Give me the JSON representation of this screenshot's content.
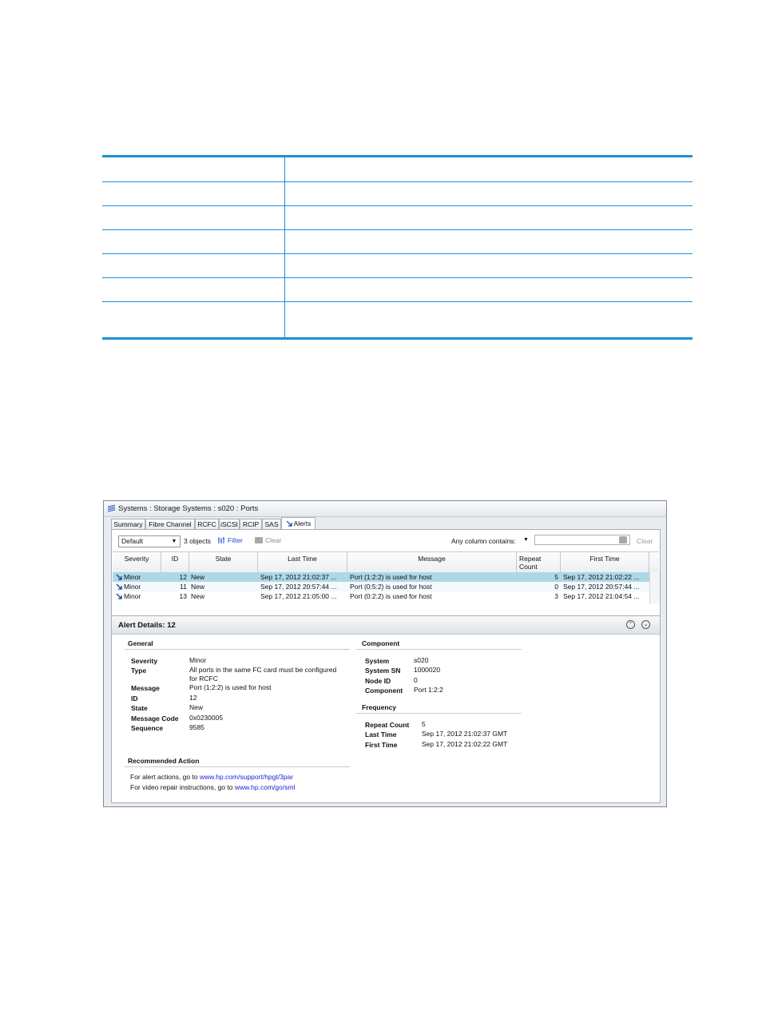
{
  "window": {
    "title": "Systems : Storage Systems : s020 : Ports"
  },
  "tabs": [
    "Summary",
    "Fibre Channel",
    "RCFC",
    "iSCSI",
    "RCIP",
    "SAS",
    "Alerts"
  ],
  "active_tab": "Alerts",
  "toolbar": {
    "filter_select": "Default",
    "object_count": "3 objects",
    "filter_label": "Filter",
    "clear_label": "Clear",
    "search_label": "Any column contains:",
    "search_value": "",
    "search_clear_label": "Clear"
  },
  "grid": {
    "columns": [
      "Severity",
      "ID",
      "State",
      "Last Time",
      "Message",
      "Repeat Count",
      "First Time"
    ],
    "rows": [
      {
        "severity": "Minor",
        "id": "12",
        "state": "New",
        "last_time": "Sep 17, 2012 21:02:37 ...",
        "message": "Port (1:2:2) is used for host",
        "repeat": "5",
        "first_time": "Sep 17, 2012 21:02:22 ..."
      },
      {
        "severity": "Minor",
        "id": "11",
        "state": "New",
        "last_time": "Sep 17, 2012 20:57:44 ...",
        "message": "Port (0:5:2) is used for host",
        "repeat": "0",
        "first_time": "Sep 17, 2012 20:57:44 ..."
      },
      {
        "severity": "Minor",
        "id": "13",
        "state": "New",
        "last_time": "Sep 17, 2012 21:05:00 ...",
        "message": "Port (0:2:2) is used for host",
        "repeat": "3",
        "first_time": "Sep 17, 2012 21:04:54 ..."
      }
    ],
    "selected_row": 0
  },
  "details": {
    "title": "Alert Details: 12",
    "general": {
      "title": "General",
      "severity_label": "Severity",
      "severity": "Minor",
      "type_label": "Type",
      "type_line1": "All ports in the same FC card must be configured",
      "type_line2": "for RCFC",
      "message_label": "Message",
      "message": "Port (1:2:2) is used for host",
      "id_label": "ID",
      "id": "12",
      "state_label": "State",
      "state": "New",
      "code_label": "Message Code",
      "code": "0x0230005",
      "sequence_label": "Sequence",
      "sequence": "9585"
    },
    "component": {
      "title": "Component",
      "system_label": "System",
      "system": "s020",
      "sn_label": "System SN",
      "sn": "1000020",
      "node_label": "Node ID",
      "node": "0",
      "component_label": "Component",
      "component": "Port 1:2:2"
    },
    "frequency": {
      "title": "Frequency",
      "repeat_label": "Repeat Count",
      "repeat": "5",
      "last_label": "Last Time",
      "last": "Sep 17, 2012 21:02:37 GMT",
      "first_label": "First Time",
      "first": "Sep 17, 2012 21:02:22 GMT"
    },
    "recommended": {
      "title": "Recommended Action",
      "line1_text": "For alert actions, go to ",
      "line1_link": "www.hp.com/support/hpgt/3par",
      "line2_text": "For video repair instructions, go to ",
      "line2_link": "www.hp.com/go/sml"
    }
  },
  "colors": {
    "table_rule": "#1d8fd6",
    "selected_row": "#add8e6",
    "link": "#1a23d6"
  }
}
